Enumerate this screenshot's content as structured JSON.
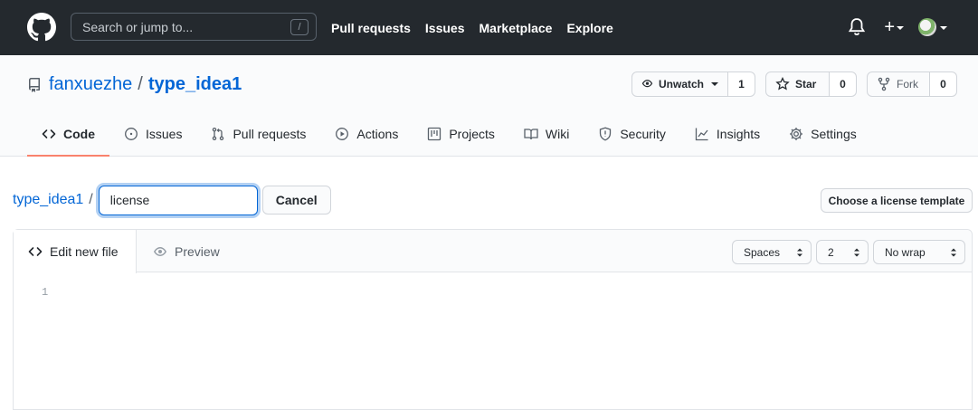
{
  "header": {
    "search_placeholder": "Search or jump to...",
    "search_shortcut": "/",
    "nav": [
      "Pull requests",
      "Issues",
      "Marketplace",
      "Explore"
    ],
    "plus_label": "+"
  },
  "repo": {
    "owner": "fanxuezhe",
    "separator": "/",
    "name": "type_idea1",
    "watch_label": "Unwatch",
    "watch_count": "1",
    "star_label": "Star",
    "star_count": "0",
    "fork_label": "Fork",
    "fork_count": "0"
  },
  "tabs": [
    {
      "label": "Code",
      "icon": "code-icon",
      "active": true
    },
    {
      "label": "Issues",
      "icon": "issue-icon"
    },
    {
      "label": "Pull requests",
      "icon": "pull-request-icon"
    },
    {
      "label": "Actions",
      "icon": "play-icon"
    },
    {
      "label": "Projects",
      "icon": "project-icon"
    },
    {
      "label": "Wiki",
      "icon": "book-icon"
    },
    {
      "label": "Security",
      "icon": "shield-icon"
    },
    {
      "label": "Insights",
      "icon": "graph-icon"
    },
    {
      "label": "Settings",
      "icon": "gear-icon"
    }
  ],
  "path": {
    "repo_link": "type_idea1",
    "separator": "/",
    "filename_value": "license",
    "cancel_label": "Cancel",
    "license_template_label": "Choose a license template"
  },
  "editor": {
    "edit_tab": "Edit new file",
    "preview_tab": "Preview",
    "indent_mode": "Spaces",
    "indent_size": "2",
    "wrap_mode": "No wrap",
    "line_number": "1"
  },
  "colors": {
    "header_bg": "#24292e",
    "link": "#0366d6",
    "active_tab_underline": "#f9826c"
  }
}
